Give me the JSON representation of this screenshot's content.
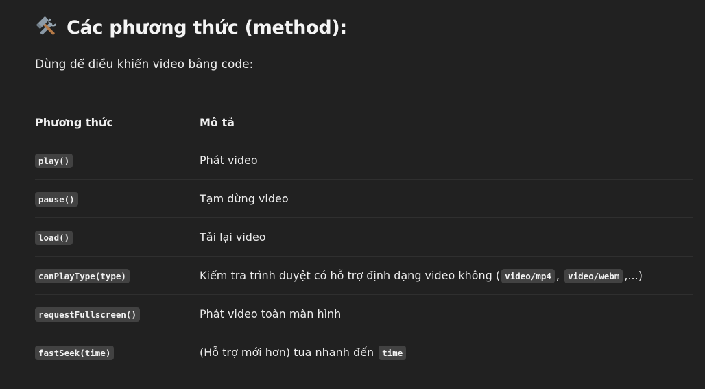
{
  "heading": {
    "icon": "hammer-and-wrench-icon",
    "title": "Các phương thức (method):"
  },
  "intro": "Dùng để điều khiển video bằng code:",
  "table": {
    "headers": [
      "Phương thức",
      "Mô tả"
    ],
    "rows": [
      {
        "method": "play()",
        "desc": "Phát video"
      },
      {
        "method": "pause()",
        "desc": "Tạm dừng video"
      },
      {
        "method": "load()",
        "desc": "Tải lại video"
      },
      {
        "method": "canPlayType(type)",
        "desc_pre": "Kiểm tra trình duyệt có hỗ trợ định dạng video không (",
        "desc_code1": "video/mp4",
        "desc_mid": ",",
        "desc_code2": "video/webm",
        "desc_post": ",...)"
      },
      {
        "method": "requestFullscreen()",
        "desc": "Phát video toàn màn hình"
      },
      {
        "method": "fastSeek(time)",
        "desc_pre": "(Hỗ trợ mới hơn) tua nhanh đến",
        "desc_code1": "time"
      }
    ]
  }
}
